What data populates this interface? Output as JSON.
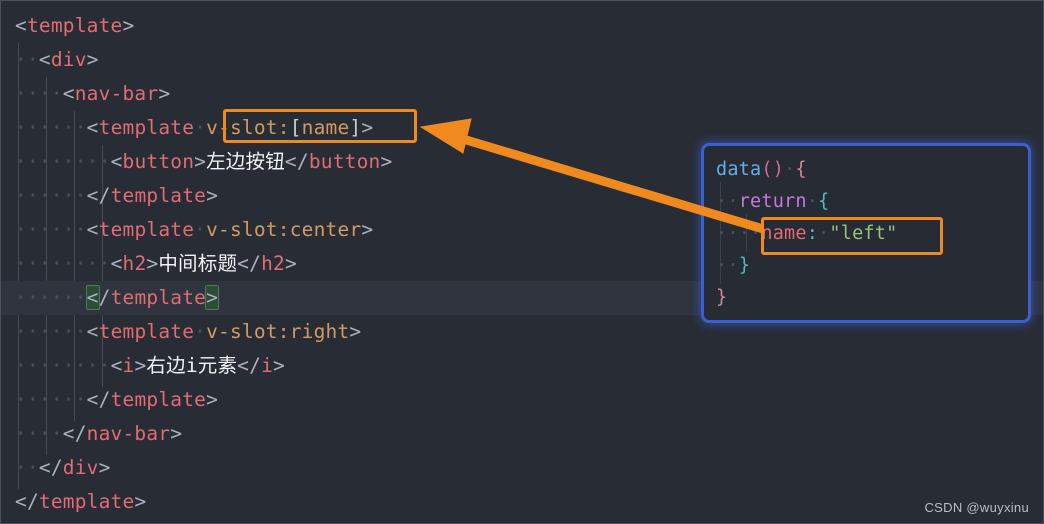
{
  "editor": {
    "background_color": "#282c34",
    "lines": [
      {
        "indent": 0,
        "tokens": [
          {
            "t": "<",
            "c": "pun"
          },
          {
            "t": "template",
            "c": "tag"
          },
          {
            "t": ">",
            "c": "pun"
          }
        ]
      },
      {
        "indent": 1,
        "tokens": [
          {
            "t": "<",
            "c": "pun"
          },
          {
            "t": "div",
            "c": "tag"
          },
          {
            "t": ">",
            "c": "pun"
          }
        ]
      },
      {
        "indent": 2,
        "tokens": [
          {
            "t": "<",
            "c": "pun"
          },
          {
            "t": "nav-bar",
            "c": "tag"
          },
          {
            "t": ">",
            "c": "pun"
          }
        ]
      },
      {
        "indent": 3,
        "tokens": [
          {
            "t": "<",
            "c": "pun"
          },
          {
            "t": "template",
            "c": "tag"
          },
          {
            "t": "·",
            "c": "ws"
          },
          {
            "t": "v-slot:",
            "c": "attr"
          },
          {
            "t": "[",
            "c": "brk"
          },
          {
            "t": "name",
            "c": "attr"
          },
          {
            "t": "]",
            "c": "brk"
          },
          {
            "t": ">",
            "c": "pun"
          }
        ]
      },
      {
        "indent": 4,
        "tokens": [
          {
            "t": "<",
            "c": "pun"
          },
          {
            "t": "button",
            "c": "tag"
          },
          {
            "t": ">",
            "c": "pun"
          },
          {
            "t": "左边按钮",
            "c": "txt"
          },
          {
            "t": "</",
            "c": "pun"
          },
          {
            "t": "button",
            "c": "tag"
          },
          {
            "t": ">",
            "c": "pun"
          }
        ]
      },
      {
        "indent": 3,
        "tokens": [
          {
            "t": "</",
            "c": "pun"
          },
          {
            "t": "template",
            "c": "tag"
          },
          {
            "t": ">",
            "c": "pun"
          }
        ]
      },
      {
        "indent": 3,
        "tokens": [
          {
            "t": "<",
            "c": "pun"
          },
          {
            "t": "template",
            "c": "tag"
          },
          {
            "t": "·",
            "c": "ws"
          },
          {
            "t": "v-slot:center",
            "c": "attr"
          },
          {
            "t": ">",
            "c": "pun"
          }
        ]
      },
      {
        "indent": 4,
        "tokens": [
          {
            "t": "<",
            "c": "pun"
          },
          {
            "t": "h2",
            "c": "tag"
          },
          {
            "t": ">",
            "c": "pun"
          },
          {
            "t": "中间标题",
            "c": "txt"
          },
          {
            "t": "</",
            "c": "pun"
          },
          {
            "t": "h2",
            "c": "tag"
          },
          {
            "t": ">",
            "c": "pun"
          }
        ]
      },
      {
        "indent": 3,
        "highlight": true,
        "tokens": [
          {
            "t": "<",
            "c": "pun bmatch"
          },
          {
            "t": "/",
            "c": "pun"
          },
          {
            "t": "template",
            "c": "tag"
          },
          {
            "t": ">",
            "c": "pun bmatch"
          }
        ]
      },
      {
        "indent": 3,
        "tokens": [
          {
            "t": "<",
            "c": "pun"
          },
          {
            "t": "template",
            "c": "tag"
          },
          {
            "t": "·",
            "c": "ws"
          },
          {
            "t": "v-slot:right",
            "c": "attr"
          },
          {
            "t": ">",
            "c": "pun"
          }
        ]
      },
      {
        "indent": 4,
        "tokens": [
          {
            "t": "<",
            "c": "pun"
          },
          {
            "t": "i",
            "c": "tag"
          },
          {
            "t": ">",
            "c": "pun"
          },
          {
            "t": "右边i元素",
            "c": "txt"
          },
          {
            "t": "</",
            "c": "pun"
          },
          {
            "t": "i",
            "c": "tag"
          },
          {
            "t": ">",
            "c": "pun"
          }
        ]
      },
      {
        "indent": 3,
        "tokens": [
          {
            "t": "</",
            "c": "pun"
          },
          {
            "t": "template",
            "c": "tag"
          },
          {
            "t": ">",
            "c": "pun"
          }
        ]
      },
      {
        "indent": 2,
        "tokens": [
          {
            "t": "</",
            "c": "pun"
          },
          {
            "t": "nav-bar",
            "c": "tag"
          },
          {
            "t": ">",
            "c": "pun"
          }
        ]
      },
      {
        "indent": 1,
        "tokens": [
          {
            "t": "</",
            "c": "pun"
          },
          {
            "t": "div",
            "c": "tag"
          },
          {
            "t": ">",
            "c": "pun"
          }
        ]
      },
      {
        "indent": 0,
        "tokens": [
          {
            "t": "</",
            "c": "pun"
          },
          {
            "t": "template",
            "c": "tag"
          },
          {
            "t": ">",
            "c": "pun"
          }
        ]
      }
    ]
  },
  "panel": {
    "border_color": "#3c5fd0",
    "background_color": "#272b33",
    "lines": [
      {
        "indent": 0,
        "tokens": [
          {
            "t": "data",
            "c": "fn"
          },
          {
            "t": "()",
            "c": "magenta"
          },
          {
            "t": "·",
            "c": "ws"
          },
          {
            "t": "{",
            "c": "brace"
          }
        ]
      },
      {
        "indent": 1,
        "tokens": [
          {
            "t": "return",
            "c": "kw"
          },
          {
            "t": "·",
            "c": "ws"
          },
          {
            "t": "{",
            "c": "colon"
          }
        ]
      },
      {
        "indent": 2,
        "tokens": [
          {
            "t": "name",
            "c": "prop"
          },
          {
            "t": ":",
            "c": "colon"
          },
          {
            "t": "·",
            "c": "ws"
          },
          {
            "t": "\"left\"",
            "c": "str"
          }
        ]
      },
      {
        "indent": 1,
        "tokens": [
          {
            "t": "}",
            "c": "colon"
          }
        ]
      },
      {
        "indent": 0,
        "tokens": [
          {
            "t": "}",
            "c": "brace"
          }
        ]
      }
    ]
  },
  "annotations": {
    "highlight_color": "#f08a1e",
    "boxes": [
      {
        "name": "v-slot-[name]-highlight",
        "target": "v-slot:[name]"
      },
      {
        "name": "name-left-highlight",
        "target": "name: \"left\""
      }
    ],
    "arrow": {
      "from": "name: \"left\"",
      "to": "v-slot:[name]",
      "color": "#f08a1e"
    }
  },
  "watermark": {
    "text": "CSDN @wuyxinu"
  }
}
